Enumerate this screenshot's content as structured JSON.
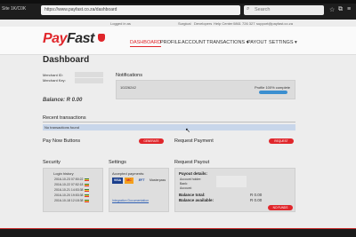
{
  "browser": {
    "status_label": "Site 1K/C0K",
    "url": "https://www.payfast.co.za/dashboard",
    "search_placeholder": "Search",
    "icons": [
      "star-icon",
      "bookmark-icon",
      "menu-icon"
    ]
  },
  "topline": {
    "logged_in": "Logged in as",
    "links": [
      "Surgical",
      "Developers",
      "Help Center",
      "0861 726 327",
      "support@payfast.co.za"
    ]
  },
  "brand": {
    "pay": "Pay",
    "fast": "Fast",
    "accent": "#e0262b"
  },
  "nav": {
    "items": [
      {
        "label": "DASHBOARD",
        "active": true
      },
      {
        "label": "PROFILE",
        "active": false
      },
      {
        "label": "ACCOUNT",
        "active": false
      },
      {
        "label": "TRANSACTIONS ▾",
        "active": false
      },
      {
        "label": "PAYOUT",
        "active": false
      },
      {
        "label": "SETTINGS ▾",
        "active": false
      }
    ]
  },
  "page_title": "Dashboard",
  "merchant": {
    "id_label": "Merchant ID:",
    "key_label": "Merchant Key:",
    "balance": "Balance: R 0.00"
  },
  "notifications": {
    "title": "Notifications",
    "id_text": "10226242",
    "profile_text": "Profile 100% complete",
    "profile_progress": 1.0
  },
  "recent": {
    "title": "Recent transactions",
    "empty_text": "No transactions found"
  },
  "pay_now": {
    "title": "Pay Now Buttons",
    "button": "GENERATE"
  },
  "request_payment": {
    "title": "Request Payment",
    "button": "REQUEST"
  },
  "security": {
    "title": "Security",
    "login_label": "Login history",
    "rows": [
      "2016-10-23 07:50:22",
      "2016-10-22 07:52:18",
      "2016-10-21 14:53:38",
      "2016-10-20 19:53:38",
      "2016-10-18 12:18:38"
    ]
  },
  "settings": {
    "title": "Settings",
    "accepted_label": "Accepted payments:",
    "methods": [
      "VISA",
      "MC",
      "EFT",
      "Masterpass"
    ],
    "doc_link": "Integration Documentation"
  },
  "payout": {
    "title": "Request Payout",
    "details_label": "Payout details:",
    "rows": [
      "Account holder:",
      "Bank:",
      "Account:"
    ],
    "balance_total_label": "Balance total:",
    "balance_total_value": "R 0.00",
    "balance_available_label": "Balance available:",
    "balance_available_value": "R 0.00",
    "button": "NO FUNDS"
  }
}
